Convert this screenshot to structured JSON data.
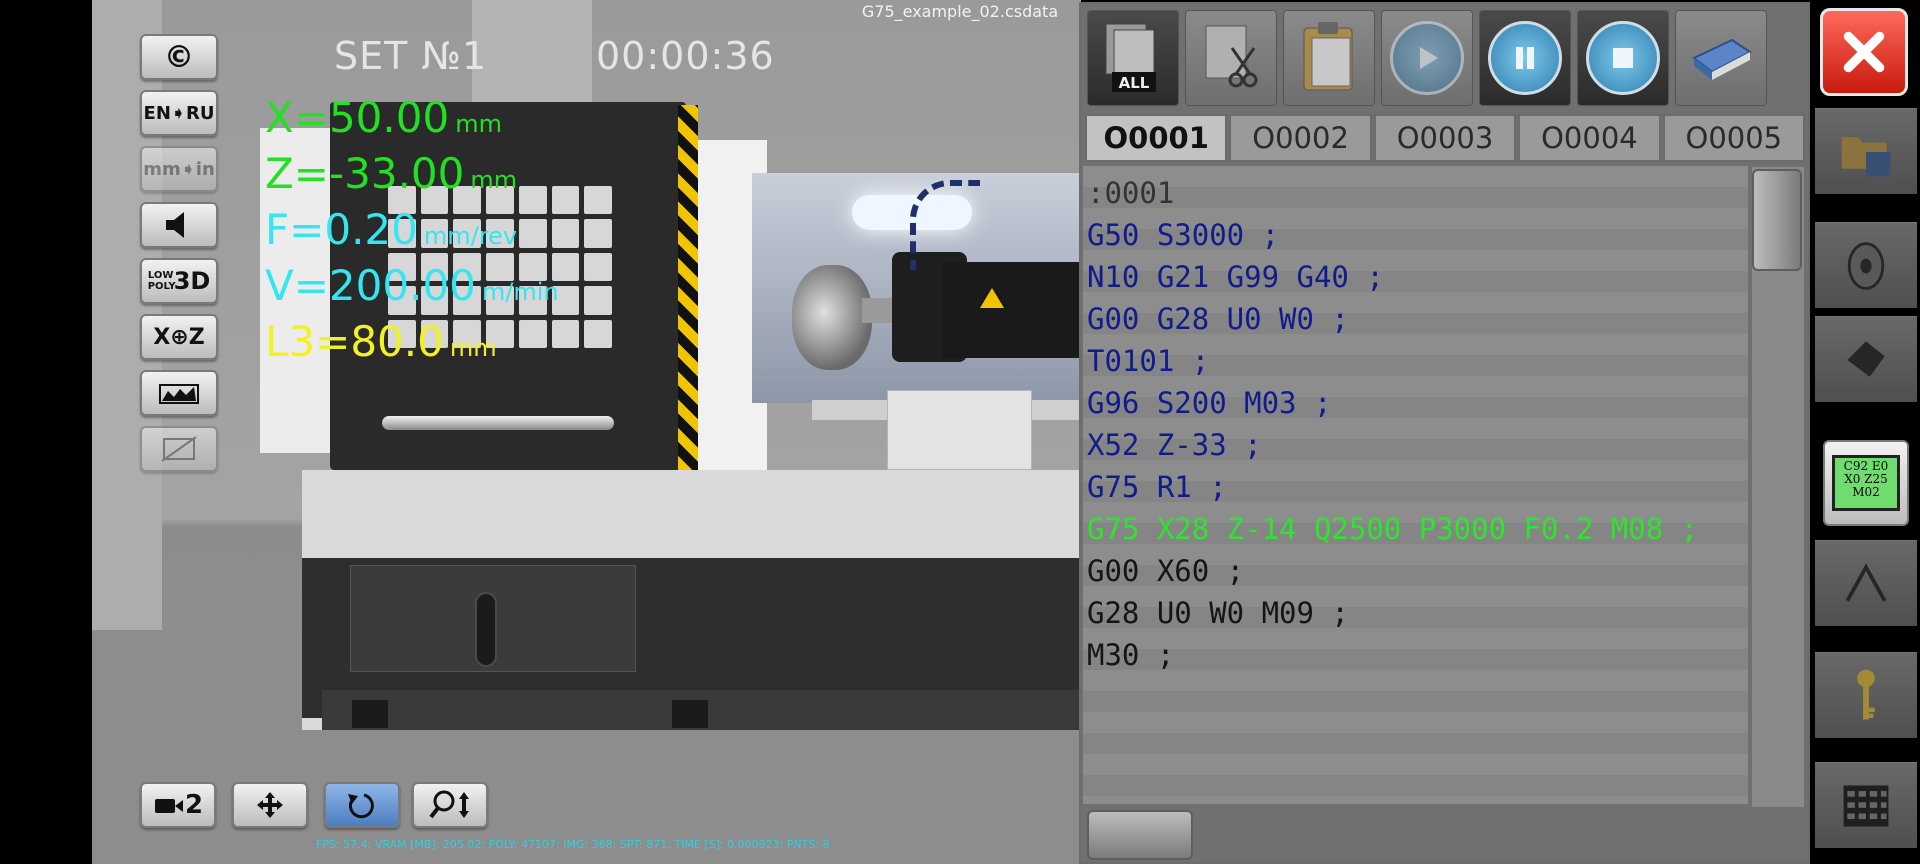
{
  "window": {
    "title": "G75_example_02.csdata"
  },
  "hud": {
    "set_label": "SET №1",
    "timer": "00:00:36",
    "coords": [
      {
        "text": "X=50.00",
        "unit": "mm",
        "color": "#22e022"
      },
      {
        "text": "Z=-33.00",
        "unit": "mm",
        "color": "#22e022"
      },
      {
        "text": "F=0.20",
        "unit": "mm/rev",
        "color": "#33e6f0"
      },
      {
        "text": "V=200.00",
        "unit": "m/min",
        "color": "#33e6f0"
      },
      {
        "text": "L3=80.0",
        "unit": "mm",
        "color": "#f2f222"
      }
    ],
    "stats": "FPS: 57.4; VRAM [MB]: 205.02; POLY: 47107; IMG: 368; SPT: 871; TIME [S]: 0.000923; PNTS: 8"
  },
  "left_toolbar": {
    "copyright": "©",
    "lang": "EN➧RU",
    "units": "mm➧in",
    "poly_small": "LOW POLY",
    "poly_big": "3D",
    "axes": "X⊕Z"
  },
  "bottom_toolbar": {
    "camera_number": "2"
  },
  "editor": {
    "tabs": [
      "O0001",
      "O0002",
      "O0003",
      "O0004",
      "O0005"
    ],
    "active_tab": 0,
    "lines": [
      {
        "text": ":0001",
        "kind": "header"
      },
      {
        "text": "G50 S3000 ;",
        "kind": "code"
      },
      {
        "text": "N10 G21 G99 G40 ;",
        "kind": "code"
      },
      {
        "text": "G00 G28 U0 W0 ;",
        "kind": "code"
      },
      {
        "text": "T0101 ;",
        "kind": "code"
      },
      {
        "text": "G96 S200 M03 ;",
        "kind": "code"
      },
      {
        "text": "X52 Z-33 ;",
        "kind": "code"
      },
      {
        "text": "G75 R1 ;",
        "kind": "code"
      },
      {
        "text": "G75 X28 Z-14 Q2500 P3000 F0.2 M08 ;",
        "kind": "current"
      },
      {
        "text": "G00 X60 ;",
        "kind": "plain"
      },
      {
        "text": "G28 U0 W0 M09 ;",
        "kind": "plain"
      },
      {
        "text": "M30 ;",
        "kind": "plain"
      }
    ],
    "toolbar_all_label": "ALL"
  },
  "right_strip": {
    "lcd_text": [
      "C92 E0",
      "X0 Z25",
      "M02"
    ]
  },
  "colors": {
    "code": "#101c8c",
    "current_line": "#2de52d",
    "executed": "#151515",
    "close": "#d8261a",
    "active_button": "#4d7ec2"
  }
}
